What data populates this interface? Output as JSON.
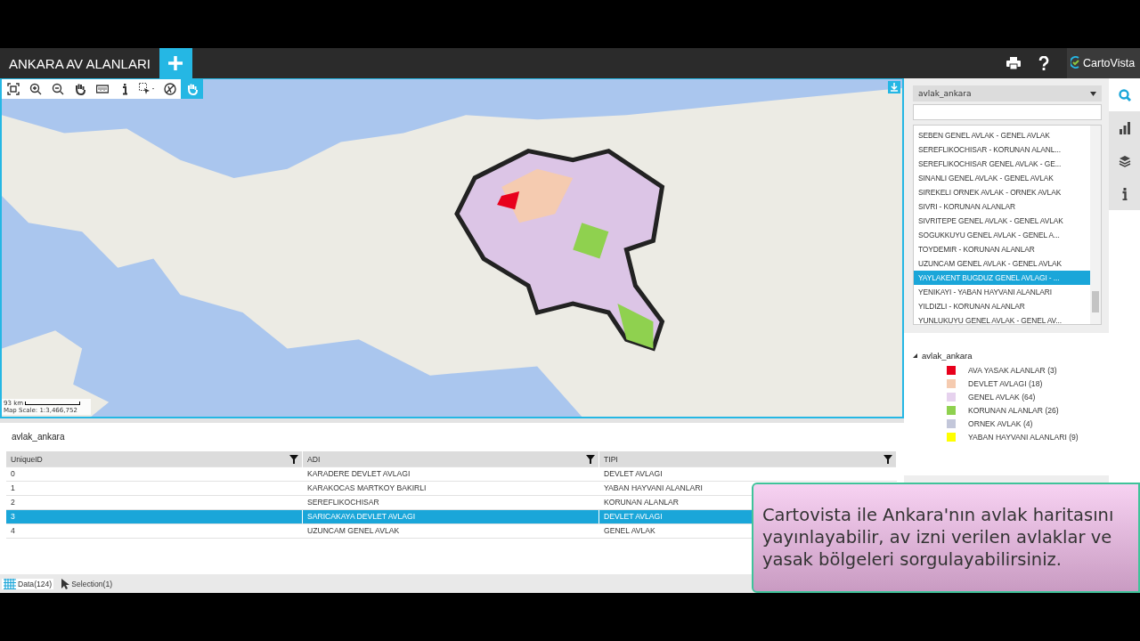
{
  "header": {
    "title": "ANKARA AV ALANLARI",
    "brand": "CartoVista"
  },
  "toolbar": [
    {
      "kind": "extent",
      "selected": false
    },
    {
      "kind": "zoom-in",
      "selected": false
    },
    {
      "kind": "zoom-out",
      "selected": false
    },
    {
      "kind": "pan",
      "selected": false
    },
    {
      "kind": "measure",
      "selected": false
    },
    {
      "kind": "info",
      "selected": false
    },
    {
      "kind": "select",
      "selected": false
    },
    {
      "kind": "clear",
      "selected": false
    },
    {
      "kind": "hand",
      "selected": true
    }
  ],
  "map": {
    "scale_distance": "93 km",
    "scale_ratio": "Map Scale: 1:3,466,752"
  },
  "layer_select": {
    "value": "avlak_ankara"
  },
  "results": [
    {
      "label": "SEBEN GENEL AVLAK - GENEL AVLAK",
      "selected": false
    },
    {
      "label": "SEREFLIKOCHISAR - KORUNAN ALANL...",
      "selected": false
    },
    {
      "label": "SEREFLIKOCHISAR GENEL AVLAK - GE...",
      "selected": false
    },
    {
      "label": "SINANLI GENEL AVLAK - GENEL AVLAK",
      "selected": false
    },
    {
      "label": "SIREKELI ORNEK AVLAK - ORNEK AVLAK",
      "selected": false
    },
    {
      "label": "SIVRI - KORUNAN ALANLAR",
      "selected": false
    },
    {
      "label": "SIVRITEPE GENEL AVLAK - GENEL AVLAK",
      "selected": false
    },
    {
      "label": "SOGUKKUYU GENEL AVLAK - GENEL A...",
      "selected": false
    },
    {
      "label": "TOYDEMIR - KORUNAN ALANLAR",
      "selected": false
    },
    {
      "label": "UZUNCAM GENEL AVLAK - GENEL AVLAK",
      "selected": false
    },
    {
      "label": "YAYLAKENT BUGDUZ GENEL AVLAGI - ...",
      "selected": true
    },
    {
      "label": "YENIKAYI - YABAN HAYVANI ALANLARI",
      "selected": false
    },
    {
      "label": "YILDIZLI - KORUNAN ALANLAR",
      "selected": false
    },
    {
      "label": "YUNLUKUYU GENEL AVLAK - GENEL AV...",
      "selected": false
    }
  ],
  "side_tabs": [
    {
      "kind": "search",
      "selected": true
    },
    {
      "kind": "chart",
      "selected": false
    },
    {
      "kind": "layers",
      "selected": false
    },
    {
      "kind": "info",
      "selected": false
    }
  ],
  "legend": {
    "layer": "avlak_ankara",
    "expanded": true,
    "items": [
      {
        "label": "AVA YASAK ALANLAR (3)",
        "color": "#e8001c"
      },
      {
        "label": "DEVLET AVLAGI (18)",
        "color": "#f5cbb0"
      },
      {
        "label": "GENEL AVLAK (64)",
        "color": "#e6d2ee"
      },
      {
        "label": "KORUNAN ALANLAR (26)",
        "color": "#8fd14f"
      },
      {
        "label": "ORNEK AVLAK (4)",
        "color": "#c3c7da"
      },
      {
        "label": "YABAN HAYVANI ALANLARI (9)",
        "color": "#ffff00"
      }
    ]
  },
  "table": {
    "title": "avlak_ankara",
    "columns": [
      "UniqueID",
      "ADI",
      "TIPI"
    ],
    "rows": [
      {
        "cells": [
          "0",
          "KARADERE DEVLET AVLAGI",
          "DEVLET AVLAGI"
        ],
        "selected": false
      },
      {
        "cells": [
          "1",
          "KARAKOCAS MARTKOY BAKIRLI",
          "YABAN HAYVANI ALANLARI"
        ],
        "selected": false
      },
      {
        "cells": [
          "2",
          "SEREFLIKOCHISAR",
          "KORUNAN ALANLAR"
        ],
        "selected": false
      },
      {
        "cells": [
          "3",
          "SARICAKAYA DEVLET AVLAGI",
          "DEVLET AVLAGI"
        ],
        "selected": true
      },
      {
        "cells": [
          "4",
          "UZUNCAM GENEL AVLAK",
          "GENEL AVLAK"
        ],
        "selected": false
      }
    ]
  },
  "status_bar": [
    {
      "kind": "data",
      "label": "Data(124)",
      "selected": true
    },
    {
      "kind": "selection",
      "label": "Selection(1)",
      "selected": false
    }
  ],
  "caption": "Cartovista ile Ankara'nın avlak haritasını yayınlayabilir, av izni verilen avlaklar ve yasak bölgeleri sorgulayabilirsiniz."
}
